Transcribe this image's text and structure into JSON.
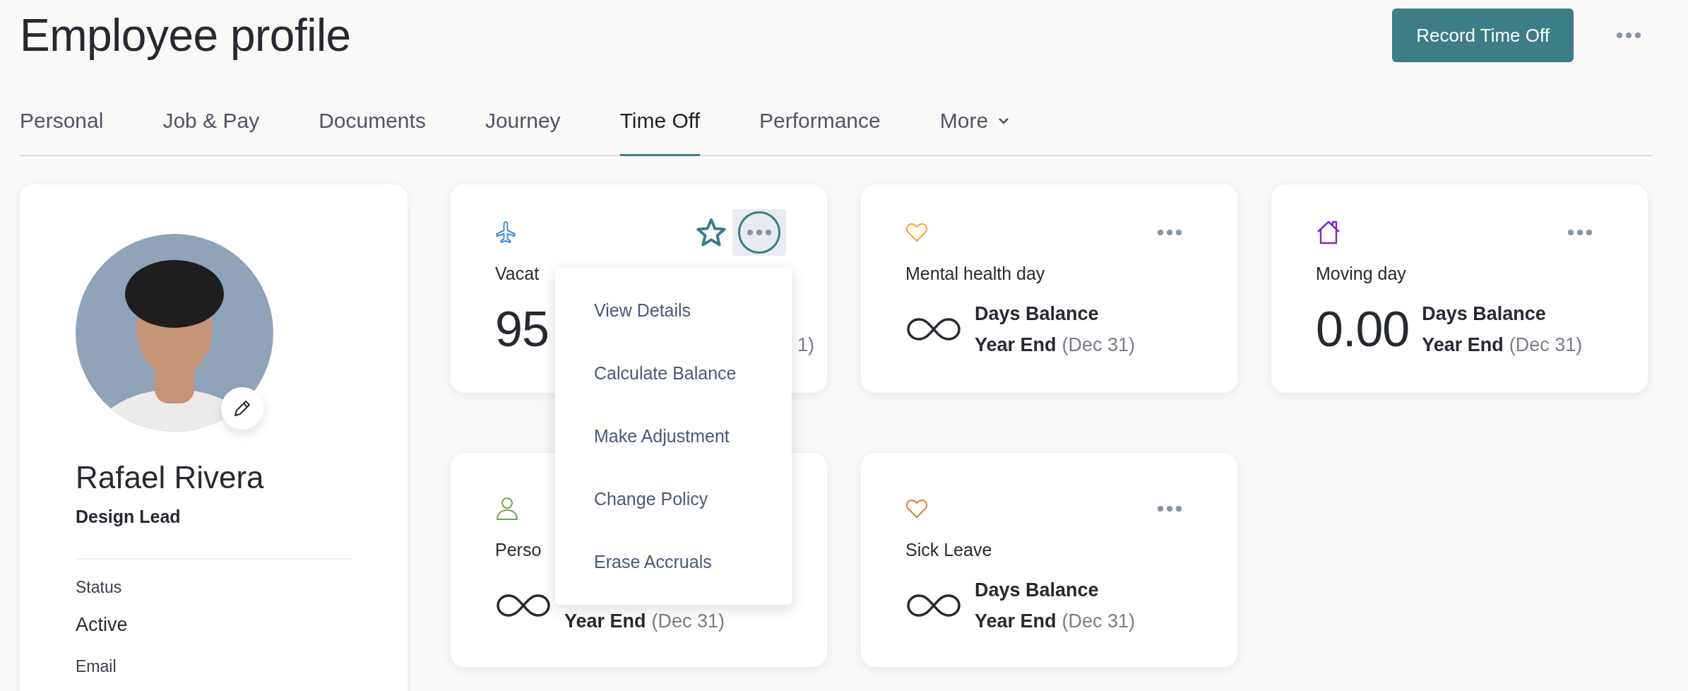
{
  "page": {
    "title": "Employee profile"
  },
  "header": {
    "primary_button": "Record Time Off"
  },
  "tabs": [
    {
      "label": "Personal",
      "selected": false,
      "kind": "tab"
    },
    {
      "label": "Job & Pay",
      "selected": false,
      "kind": "tab"
    },
    {
      "label": "Documents",
      "selected": false,
      "kind": "tab"
    },
    {
      "label": "Journey",
      "selected": false,
      "kind": "tab"
    },
    {
      "label": "Time Off",
      "selected": true,
      "kind": "tab"
    },
    {
      "label": "Performance",
      "selected": false,
      "kind": "tab"
    },
    {
      "label": "More",
      "selected": false,
      "kind": "dropdown"
    }
  ],
  "profile": {
    "name": "Rafael Rivera",
    "role": "Design Lead",
    "fields": [
      {
        "label": "Status",
        "value": "Active"
      },
      {
        "label": "Email"
      }
    ]
  },
  "cards": [
    {
      "kind": "plane",
      "color": "#3b8ad9",
      "title": "Vacat",
      "favorite": true,
      "more_button": true,
      "menu_open": true,
      "balance": {
        "kind": "number",
        "value": "95"
      },
      "date": "1)",
      "menu": {
        "items": [
          "View Details",
          "Calculate Balance",
          "Make Adjustment",
          "Change Policy",
          "Erase Accruals"
        ]
      }
    },
    {
      "kind": "heart",
      "color": "#f0a330",
      "title": "Mental health day",
      "more_button": true,
      "balance": {
        "kind": "unlimited"
      },
      "label": "Days Balance",
      "period": "Year End",
      "date": "(Dec 31)"
    },
    {
      "kind": "house",
      "color": "#7a2bbd",
      "title": "Moving day",
      "more_button": true,
      "balance": {
        "kind": "number",
        "value": "0.00"
      },
      "label": "Days Balance",
      "period": "Year End",
      "date": "(Dec 31)"
    },
    {
      "kind": "person",
      "color": "#6ea84a",
      "title": "Perso",
      "balance": {
        "kind": "unlimited"
      },
      "period": "Year End",
      "date": "(Dec 31)"
    },
    {
      "kind": "heart",
      "color": "#e8782c",
      "title": "Sick Leave",
      "more_button": true,
      "balance": {
        "kind": "unlimited"
      },
      "label": "Days Balance",
      "period": "Year End",
      "date": "(Dec 31)"
    }
  ]
}
